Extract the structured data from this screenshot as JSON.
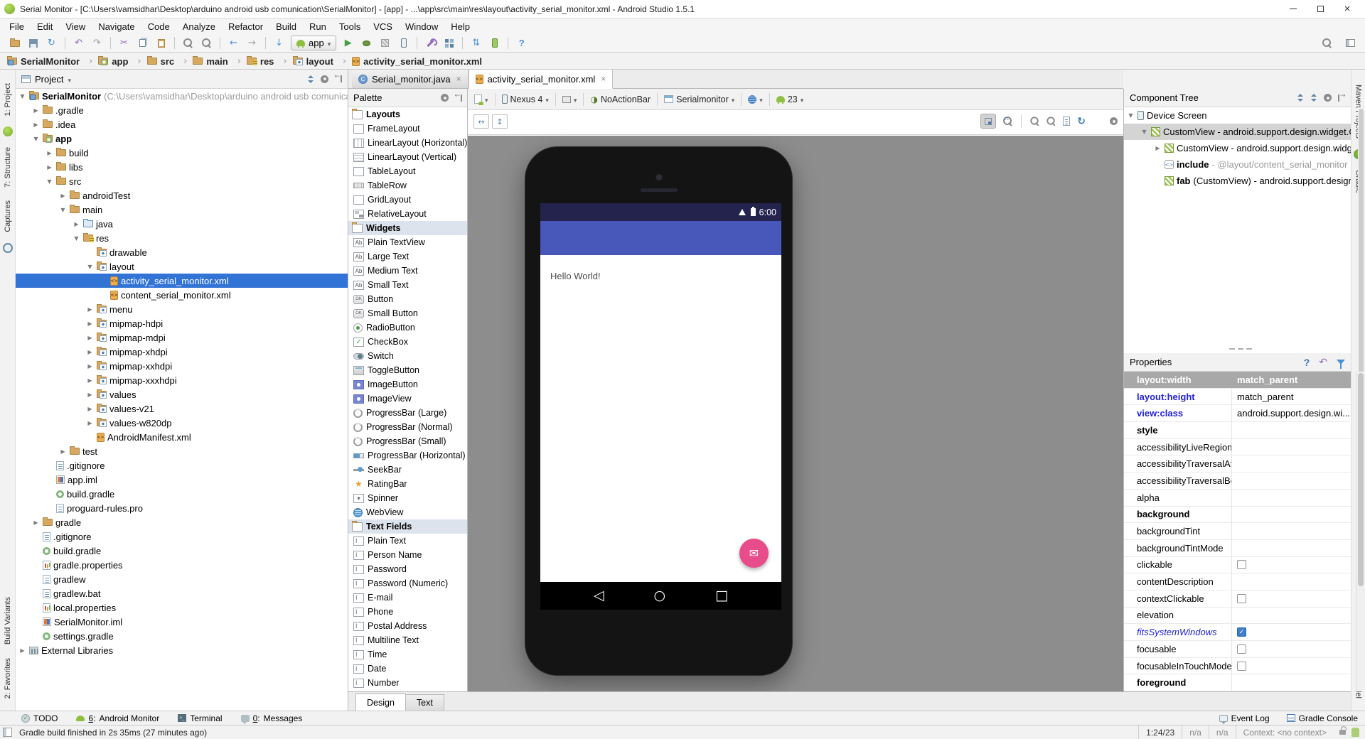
{
  "window": {
    "title": "Serial Monitor - [C:\\Users\\vamsidhar\\Desktop\\arduino android usb comunication\\SerialMonitor] - [app] - ...\\app\\src\\main\\res\\layout\\activity_serial_monitor.xml - Android Studio 1.5.1"
  },
  "menu": {
    "items": [
      {
        "label": "File"
      },
      {
        "label": "Edit"
      },
      {
        "label": "View"
      },
      {
        "label": "Navigate"
      },
      {
        "label": "Code"
      },
      {
        "label": "Analyze"
      },
      {
        "label": "Refactor"
      },
      {
        "label": "Build"
      },
      {
        "label": "Run"
      },
      {
        "label": "Tools"
      },
      {
        "label": "VCS"
      },
      {
        "label": "Window"
      },
      {
        "label": "Help"
      }
    ]
  },
  "toolbar": {
    "run_config": "app"
  },
  "breadcrumb": {
    "items": [
      {
        "icon": "folder-project",
        "label": "SerialMonitor"
      },
      {
        "icon": "folder-app",
        "label": "app"
      },
      {
        "icon": "folder",
        "label": "src"
      },
      {
        "icon": "folder",
        "label": "main"
      },
      {
        "icon": "folder-res",
        "label": "res"
      },
      {
        "icon": "folder-resfile",
        "label": "layout"
      },
      {
        "icon": "xml",
        "label": "activity_serial_monitor.xml"
      }
    ]
  },
  "left_stripe": {
    "project": "1: Project",
    "structure": "7: Structure",
    "captures": "Captures",
    "build_variants": "Build Variants",
    "favorites": "2: Favorites"
  },
  "right_stripe": {
    "maven": "Maven Projects",
    "gradle": "Gradle",
    "android_model": "Android Model"
  },
  "project_panel": {
    "title": "Project",
    "tree": [
      {
        "indent": 0,
        "arrow": "▼",
        "icon": "folder-project",
        "label": "SerialMonitor",
        "g": " (C:\\Users\\vamsidhar\\Desktop\\arduino android usb comunication",
        "cls": "b"
      },
      {
        "indent": 1,
        "arrow": "▶",
        "icon": "folder",
        "label": ".gradle"
      },
      {
        "indent": 1,
        "arrow": "▶",
        "icon": "folder",
        "label": ".idea"
      },
      {
        "indent": 1,
        "arrow": "▼",
        "icon": "folder-app",
        "label": "app",
        "cls": "b"
      },
      {
        "indent": 2,
        "arrow": "▶",
        "icon": "folder",
        "label": "build"
      },
      {
        "indent": 2,
        "arrow": "▶",
        "icon": "folder",
        "label": "libs"
      },
      {
        "indent": 2,
        "arrow": "▼",
        "icon": "folder",
        "label": "src"
      },
      {
        "indent": 3,
        "arrow": "▶",
        "icon": "folder",
        "label": "androidTest"
      },
      {
        "indent": 3,
        "arrow": "▼",
        "icon": "folder",
        "label": "main"
      },
      {
        "indent": 4,
        "arrow": "▶",
        "icon": "folder-java",
        "label": "java"
      },
      {
        "indent": 4,
        "arrow": "▼",
        "icon": "folder-res",
        "label": "res"
      },
      {
        "indent": 5,
        "arrow": "",
        "icon": "folder-resfile",
        "label": "drawable"
      },
      {
        "indent": 5,
        "arrow": "▼",
        "icon": "folder-resfile",
        "label": "layout"
      },
      {
        "indent": 6,
        "arrow": "",
        "icon": "xml",
        "label": "activity_serial_monitor.xml",
        "cls": "sel"
      },
      {
        "indent": 6,
        "arrow": "",
        "icon": "xml",
        "label": "content_serial_monitor.xml"
      },
      {
        "indent": 5,
        "arrow": "▶",
        "icon": "folder-resfile",
        "label": "menu"
      },
      {
        "indent": 5,
        "arrow": "▶",
        "icon": "folder-resfile",
        "label": "mipmap-hdpi"
      },
      {
        "indent": 5,
        "arrow": "▶",
        "icon": "folder-resfile",
        "label": "mipmap-mdpi"
      },
      {
        "indent": 5,
        "arrow": "▶",
        "icon": "folder-resfile",
        "label": "mipmap-xhdpi"
      },
      {
        "indent": 5,
        "arrow": "▶",
        "icon": "folder-resfile",
        "label": "mipmap-xxhdpi"
      },
      {
        "indent": 5,
        "arrow": "▶",
        "icon": "folder-resfile",
        "label": "mipmap-xxxhdpi"
      },
      {
        "indent": 5,
        "arrow": "▶",
        "icon": "folder-resfile",
        "label": "values"
      },
      {
        "indent": 5,
        "arrow": "▶",
        "icon": "folder-resfile",
        "label": "values-v21"
      },
      {
        "indent": 5,
        "arrow": "▶",
        "icon": "folder-resfile",
        "label": "values-w820dp"
      },
      {
        "indent": 5,
        "arrow": "",
        "icon": "xml",
        "label": "AndroidManifest.xml"
      },
      {
        "indent": 3,
        "arrow": "▶",
        "icon": "folder",
        "label": "test"
      },
      {
        "indent": 2,
        "arrow": "",
        "icon": "file",
        "label": ".gitignore"
      },
      {
        "indent": 2,
        "arrow": "",
        "icon": "iml",
        "label": "app.iml"
      },
      {
        "indent": 2,
        "arrow": "",
        "icon": "gradle",
        "label": "build.gradle"
      },
      {
        "indent": 2,
        "arrow": "",
        "icon": "file",
        "label": "proguard-rules.pro"
      },
      {
        "indent": 1,
        "arrow": "▶",
        "icon": "folder",
        "label": "gradle"
      },
      {
        "indent": 1,
        "arrow": "",
        "icon": "file",
        "label": ".gitignore"
      },
      {
        "indent": 1,
        "arrow": "",
        "icon": "gradle",
        "label": "build.gradle"
      },
      {
        "indent": 1,
        "arrow": "",
        "icon": "props",
        "label": "gradle.properties"
      },
      {
        "indent": 1,
        "arrow": "",
        "icon": "file",
        "label": "gradlew"
      },
      {
        "indent": 1,
        "arrow": "",
        "icon": "file",
        "label": "gradlew.bat"
      },
      {
        "indent": 1,
        "arrow": "",
        "icon": "props",
        "label": "local.properties"
      },
      {
        "indent": 1,
        "arrow": "",
        "icon": "iml",
        "label": "SerialMonitor.iml"
      },
      {
        "indent": 1,
        "arrow": "",
        "icon": "gradle",
        "label": "settings.gradle"
      },
      {
        "indent": 0,
        "arrow": "▶",
        "icon": "lib",
        "label": "External Libraries"
      }
    ]
  },
  "editor": {
    "tabs": [
      {
        "icon": "class",
        "label": "Serial_monitor.java",
        "close": "×"
      },
      {
        "icon": "xml",
        "label": "activity_serial_monitor.xml",
        "close": "×",
        "cls": "active"
      }
    ]
  },
  "palette": {
    "title": "Palette",
    "items": [
      {
        "cls": "sec",
        "icon": "folder-hdr",
        "label": "Layouts"
      },
      {
        "icon": "lay-frame",
        "label": "FrameLayout"
      },
      {
        "icon": "lay-linh",
        "label": "LinearLayout (Horizontal)"
      },
      {
        "icon": "lay-linv",
        "label": "LinearLayout (Vertical)"
      },
      {
        "icon": "lay-table",
        "label": "TableLayout"
      },
      {
        "icon": "lay-row",
        "label": "TableRow"
      },
      {
        "icon": "lay-grid",
        "label": "GridLayout"
      },
      {
        "icon": "lay-rel",
        "label": "RelativeLayout"
      },
      {
        "cls": "sec tint",
        "icon": "folder-hdr",
        "label": "Widgets"
      },
      {
        "icon": "w-ab",
        "label": "Plain TextView"
      },
      {
        "icon": "w-ab",
        "label": "Large Text"
      },
      {
        "icon": "w-ab",
        "label": "Medium Text"
      },
      {
        "icon": "w-ab",
        "label": "Small Text"
      },
      {
        "icon": "w-btn",
        "label": "Button"
      },
      {
        "icon": "w-btn",
        "label": "Small Button"
      },
      {
        "icon": "w-radio",
        "label": "RadioButton"
      },
      {
        "icon": "w-check",
        "label": "CheckBox"
      },
      {
        "icon": "w-switch",
        "label": "Switch"
      },
      {
        "icon": "w-toggle",
        "label": "ToggleButton"
      },
      {
        "icon": "w-imgb",
        "label": "ImageButton"
      },
      {
        "icon": "w-imgv",
        "label": "ImageView"
      },
      {
        "icon": "w-prog",
        "label": "ProgressBar (Large)"
      },
      {
        "icon": "w-prog",
        "label": "ProgressBar (Normal)"
      },
      {
        "icon": "w-prog",
        "label": "ProgressBar (Small)"
      },
      {
        "icon": "w-progh",
        "label": "ProgressBar (Horizontal)"
      },
      {
        "icon": "w-seek",
        "label": "SeekBar"
      },
      {
        "icon": "w-star",
        "label": "RatingBar"
      },
      {
        "icon": "w-spin",
        "label": "Spinner"
      },
      {
        "icon": "w-web",
        "label": "WebView"
      },
      {
        "cls": "sec tint",
        "icon": "folder-hdr",
        "label": "Text Fields"
      },
      {
        "icon": "w-tf",
        "label": "Plain Text"
      },
      {
        "icon": "w-tf",
        "label": "Person Name"
      },
      {
        "icon": "w-tf",
        "label": "Password"
      },
      {
        "icon": "w-tf",
        "label": "Password (Numeric)"
      },
      {
        "icon": "w-tf",
        "label": "E-mail"
      },
      {
        "icon": "w-tf",
        "label": "Phone"
      },
      {
        "icon": "w-tf",
        "label": "Postal Address"
      },
      {
        "icon": "w-tf",
        "label": "Multiline Text"
      },
      {
        "icon": "w-tf",
        "label": "Time"
      },
      {
        "icon": "w-tf",
        "label": "Date"
      },
      {
        "icon": "w-tf",
        "label": "Number"
      }
    ]
  },
  "design": {
    "toolbar": {
      "device": "Nexus 4",
      "theme": "NoActionBar",
      "activity": "Serialmonitor",
      "api": "23"
    },
    "tabs": [
      {
        "label": "Design",
        "cls": "active"
      },
      {
        "label": "Text"
      }
    ],
    "phone": {
      "time": "6:00",
      "hello": "Hello World!"
    }
  },
  "component_tree": {
    "title": "Component Tree",
    "rows": [
      {
        "indent": 0,
        "arrow": "▼",
        "icon": "device-screen",
        "t": "Device Screen"
      },
      {
        "indent": 1,
        "arrow": "▼",
        "icon": "customview",
        "t": "CustomView - android.support.design.widget.Co",
        "cls": "sel"
      },
      {
        "indent": 2,
        "arrow": "▶",
        "icon": "customview",
        "t": "CustomView - android.support.design.widget"
      },
      {
        "indent": 2,
        "arrow": "",
        "icon": "include",
        "b": "include",
        "g": " - @layout/content_serial_monitor"
      },
      {
        "indent": 2,
        "arrow": "",
        "icon": "customview",
        "b": "fab",
        "t": " (CustomView) - android.support.design.w"
      }
    ]
  },
  "properties": {
    "title": "Properties",
    "rows": [
      {
        "label": "layout:width",
        "value": "match_parent",
        "cls": "sel"
      },
      {
        "label": "layout:height",
        "value": "match_parent",
        "cls": "bblue"
      },
      {
        "label": "view:class",
        "value": "android.support.design.wi...",
        "cls": "bblue"
      },
      {
        "label": "style",
        "cls": "bold"
      },
      {
        "label": "accessibilityLiveRegion"
      },
      {
        "label": "accessibilityTraversalAfter"
      },
      {
        "label": "accessibilityTraversalBefore"
      },
      {
        "label": "alpha"
      },
      {
        "label": "background",
        "cls": "bold"
      },
      {
        "label": "backgroundTint"
      },
      {
        "label": "backgroundTintMode"
      },
      {
        "label": "clickable",
        "icon": "cb"
      },
      {
        "label": "contentDescription"
      },
      {
        "label": "contextClickable",
        "icon": "cb"
      },
      {
        "label": "elevation"
      },
      {
        "label": "fitsSystemWindows",
        "cls": "iblue",
        "icon": "cbc"
      },
      {
        "label": "focusable",
        "icon": "cb"
      },
      {
        "label": "focusableInTouchMode",
        "icon": "cb"
      },
      {
        "label": "foreground",
        "cls": "bold"
      }
    ]
  },
  "bottom_bar": {
    "left": [
      {
        "icon": "todo",
        "label": "TODO"
      },
      {
        "icon": "android-head",
        "num": "6",
        "label": "Android Monitor"
      },
      {
        "icon": "terminal",
        "label": "Terminal"
      },
      {
        "icon": "messages",
        "num": "0",
        "label": "Messages"
      }
    ],
    "right": [
      {
        "icon": "eventlog",
        "label": "Event Log"
      },
      {
        "icon": "console",
        "label": "Gradle Console"
      }
    ]
  },
  "status_bar": {
    "message": "Gradle build finished in 2s 35ms (27 minutes ago)",
    "position": "1:24/23",
    "na1": "n/a",
    "na2": "n/a",
    "context": "Context: <no context>"
  }
}
